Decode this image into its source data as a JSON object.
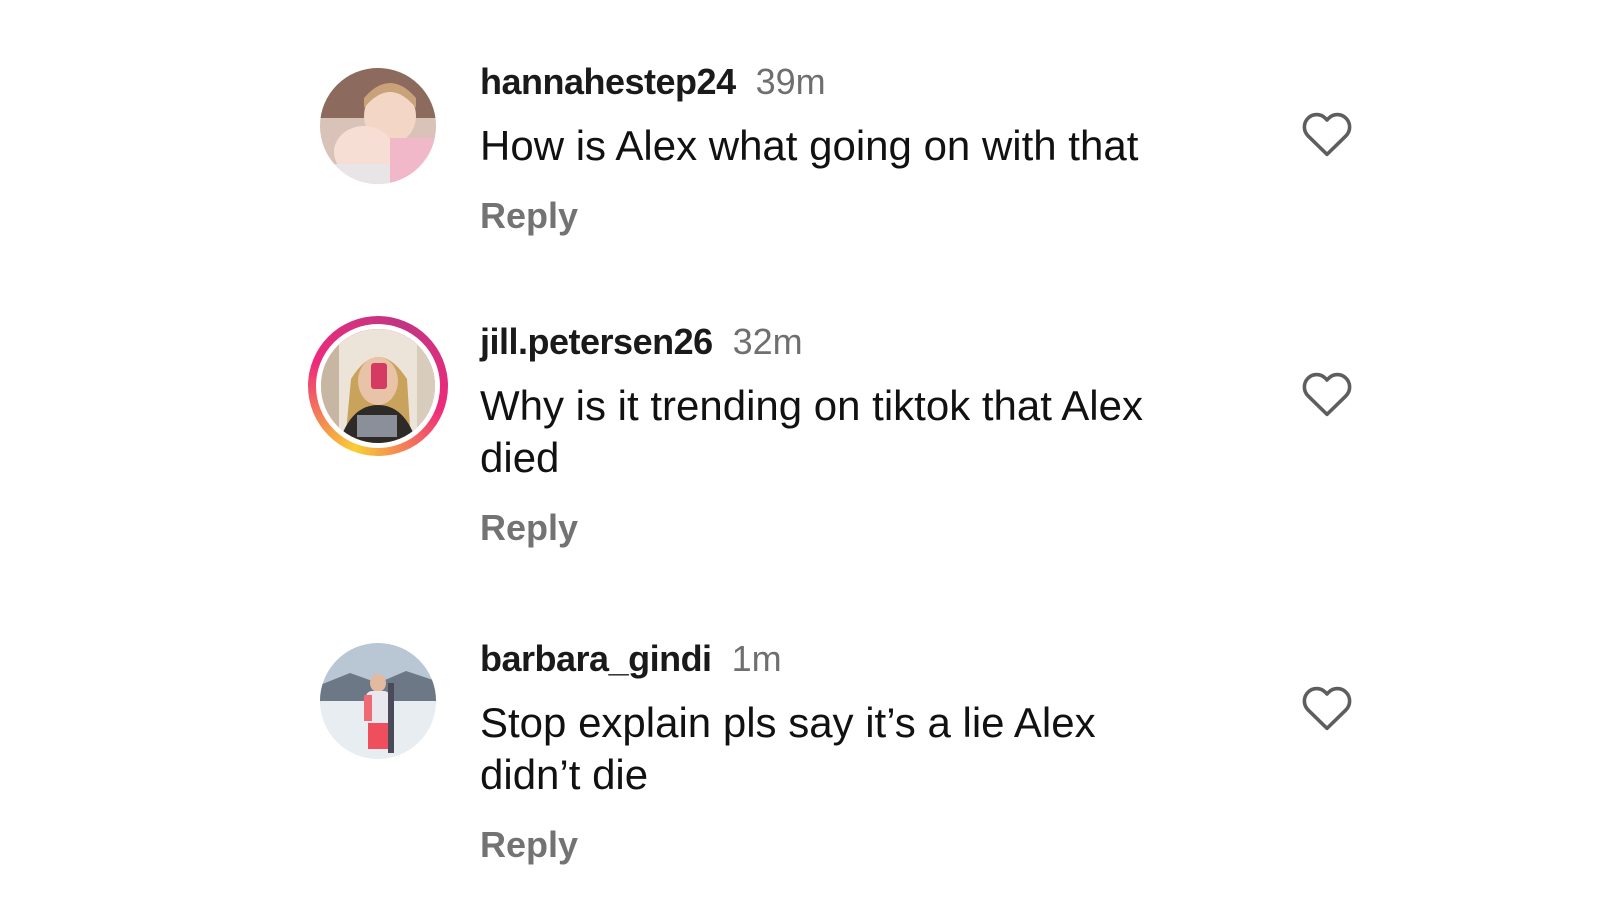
{
  "comments": [
    {
      "username": "hannahestep24",
      "time": "39m",
      "text": "How is Alex what going on with that",
      "reply_label": "Reply",
      "liked": false,
      "has_story_ring": false,
      "like_icon": "heart-outline-icon"
    },
    {
      "username": "jill.petersen26",
      "time": "32m",
      "text": "Why is it trending on tiktok that Alex died",
      "reply_label": "Reply",
      "liked": false,
      "has_story_ring": true,
      "like_icon": "heart-outline-icon"
    },
    {
      "username": "barbara_gindi",
      "time": "1m",
      "text": "Stop explain pls say it’s a lie Alex didn’t die",
      "reply_label": "Reply",
      "liked": false,
      "has_story_ring": false,
      "like_icon": "heart-outline-icon"
    }
  ],
  "colors": {
    "background": "#ffffff",
    "text": "#111111",
    "muted": "#737373",
    "story_ring_start": "#f9ce34",
    "story_ring_end": "#c13584"
  }
}
